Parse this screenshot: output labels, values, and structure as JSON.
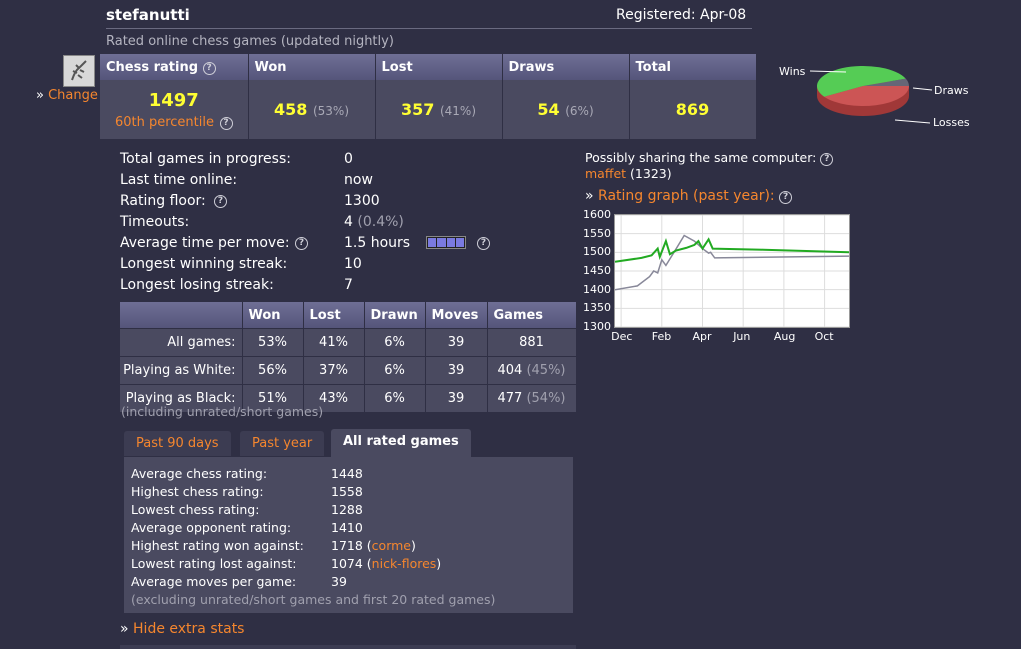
{
  "header": {
    "username": "stefanutti",
    "registered": "Registered: Apr-08",
    "subtitle": "Rated online chess games (updated nightly)"
  },
  "avatar": {
    "change_label": "Change"
  },
  "stats": {
    "headers": [
      "Chess rating",
      "Won",
      "Lost",
      "Draws",
      "Total"
    ],
    "rating": "1497",
    "percentile": "60th percentile",
    "won": "458",
    "won_pct": "(53%)",
    "lost": "357",
    "lost_pct": "(41%)",
    "draws": "54",
    "draws_pct": "(6%)",
    "total": "869"
  },
  "pie": {
    "labels": {
      "wins": "Wins",
      "draws": "Draws",
      "losses": "Losses"
    },
    "colors": {
      "wins": "#55cc55",
      "draws": "#666677",
      "losses": "#cc5555"
    },
    "fractions": {
      "wins": 0.53,
      "losses": 0.41,
      "draws": 0.06
    }
  },
  "info": {
    "rows": [
      {
        "label": "Total games in progress:",
        "value": "0"
      },
      {
        "label": "Last time online:",
        "value": "now"
      },
      {
        "label": "Rating floor:",
        "value": "1300"
      },
      {
        "label": "Timeouts:",
        "value": "4",
        "extra": "(0.4%)"
      },
      {
        "label": "Average time per move:",
        "value": "1.5 hours"
      },
      {
        "label": "Longest winning streak:",
        "value": "10"
      },
      {
        "label": "Longest losing streak:",
        "value": "7"
      }
    ],
    "time_bar_segments": 4
  },
  "sharing": {
    "label": "Possibly sharing the same computer:",
    "user": "maffet",
    "user_rating": "(1323)"
  },
  "graph_link": "Rating graph (past year):",
  "chart_data": {
    "type": "line",
    "title": "",
    "y_ticks": [
      "1600",
      "1550",
      "1500",
      "1450",
      "1400",
      "1350",
      "1300"
    ],
    "ylim": [
      1300,
      1600
    ],
    "x_ticks": [
      "Dec",
      "Feb",
      "Apr",
      "Jun",
      "Aug",
      "Oct"
    ],
    "x_tick_month_index": [
      0,
      2,
      4,
      6,
      8,
      10
    ],
    "xlim_months": [
      -0.3,
      11.2
    ],
    "grid": true,
    "series": [
      {
        "color": "#22aa22",
        "points": [
          [
            -0.3,
            1475
          ],
          [
            1.0,
            1485
          ],
          [
            1.5,
            1492
          ],
          [
            1.8,
            1510
          ],
          [
            1.9,
            1488
          ],
          [
            2.2,
            1530
          ],
          [
            2.4,
            1495
          ],
          [
            2.7,
            1505
          ],
          [
            3.2,
            1512
          ],
          [
            3.6,
            1520
          ],
          [
            3.8,
            1530
          ],
          [
            4.0,
            1510
          ],
          [
            4.3,
            1535
          ],
          [
            4.5,
            1510
          ],
          [
            7,
            1507
          ],
          [
            11.2,
            1500
          ]
        ]
      },
      {
        "color": "#888899",
        "points": [
          [
            -0.3,
            1400
          ],
          [
            0.8,
            1410
          ],
          [
            1.4,
            1435
          ],
          [
            1.6,
            1450
          ],
          [
            1.8,
            1445
          ],
          [
            2.0,
            1480
          ],
          [
            2.2,
            1465
          ],
          [
            2.6,
            1500
          ],
          [
            3.1,
            1545
          ],
          [
            3.6,
            1530
          ],
          [
            4.0,
            1510
          ],
          [
            4.3,
            1498
          ],
          [
            4.4,
            1500
          ],
          [
            4.6,
            1485
          ],
          [
            11.2,
            1490
          ]
        ]
      }
    ]
  },
  "breakdown": {
    "headers": [
      "",
      "Won",
      "Lost",
      "Drawn",
      "Moves",
      "Games"
    ],
    "rows": [
      {
        "label": "All games:",
        "won": "53%",
        "lost": "41%",
        "drawn": "6%",
        "moves": "39",
        "games": "881",
        "games_pct": ""
      },
      {
        "label": "Playing as White:",
        "won": "56%",
        "lost": "37%",
        "drawn": "6%",
        "moves": "39",
        "games": "404",
        "games_pct": "(45%)"
      },
      {
        "label": "Playing as Black:",
        "won": "51%",
        "lost": "43%",
        "drawn": "6%",
        "moves": "39",
        "games": "477",
        "games_pct": "(54%)"
      }
    ],
    "note": "(including unrated/short games)"
  },
  "tabs": [
    "Past 90 days",
    "Past year",
    "All rated games"
  ],
  "tab_panel": {
    "rows": [
      {
        "label": "Average chess rating:",
        "value": "1448"
      },
      {
        "label": "Highest chess rating:",
        "value": "1558"
      },
      {
        "label": "Lowest chess rating:",
        "value": "1288"
      },
      {
        "label": "Average opponent rating:",
        "value": "1410"
      },
      {
        "label": "Highest rating won against:",
        "value": "1718",
        "link": "corme"
      },
      {
        "label": "Lowest rating lost against:",
        "value": "1074",
        "link": "nick-flores"
      },
      {
        "label": "Average moves per game:",
        "value": "39"
      }
    ],
    "note": "(excluding unrated/short games and first 20 rated games)"
  },
  "hide_stats": "Hide extra stats"
}
